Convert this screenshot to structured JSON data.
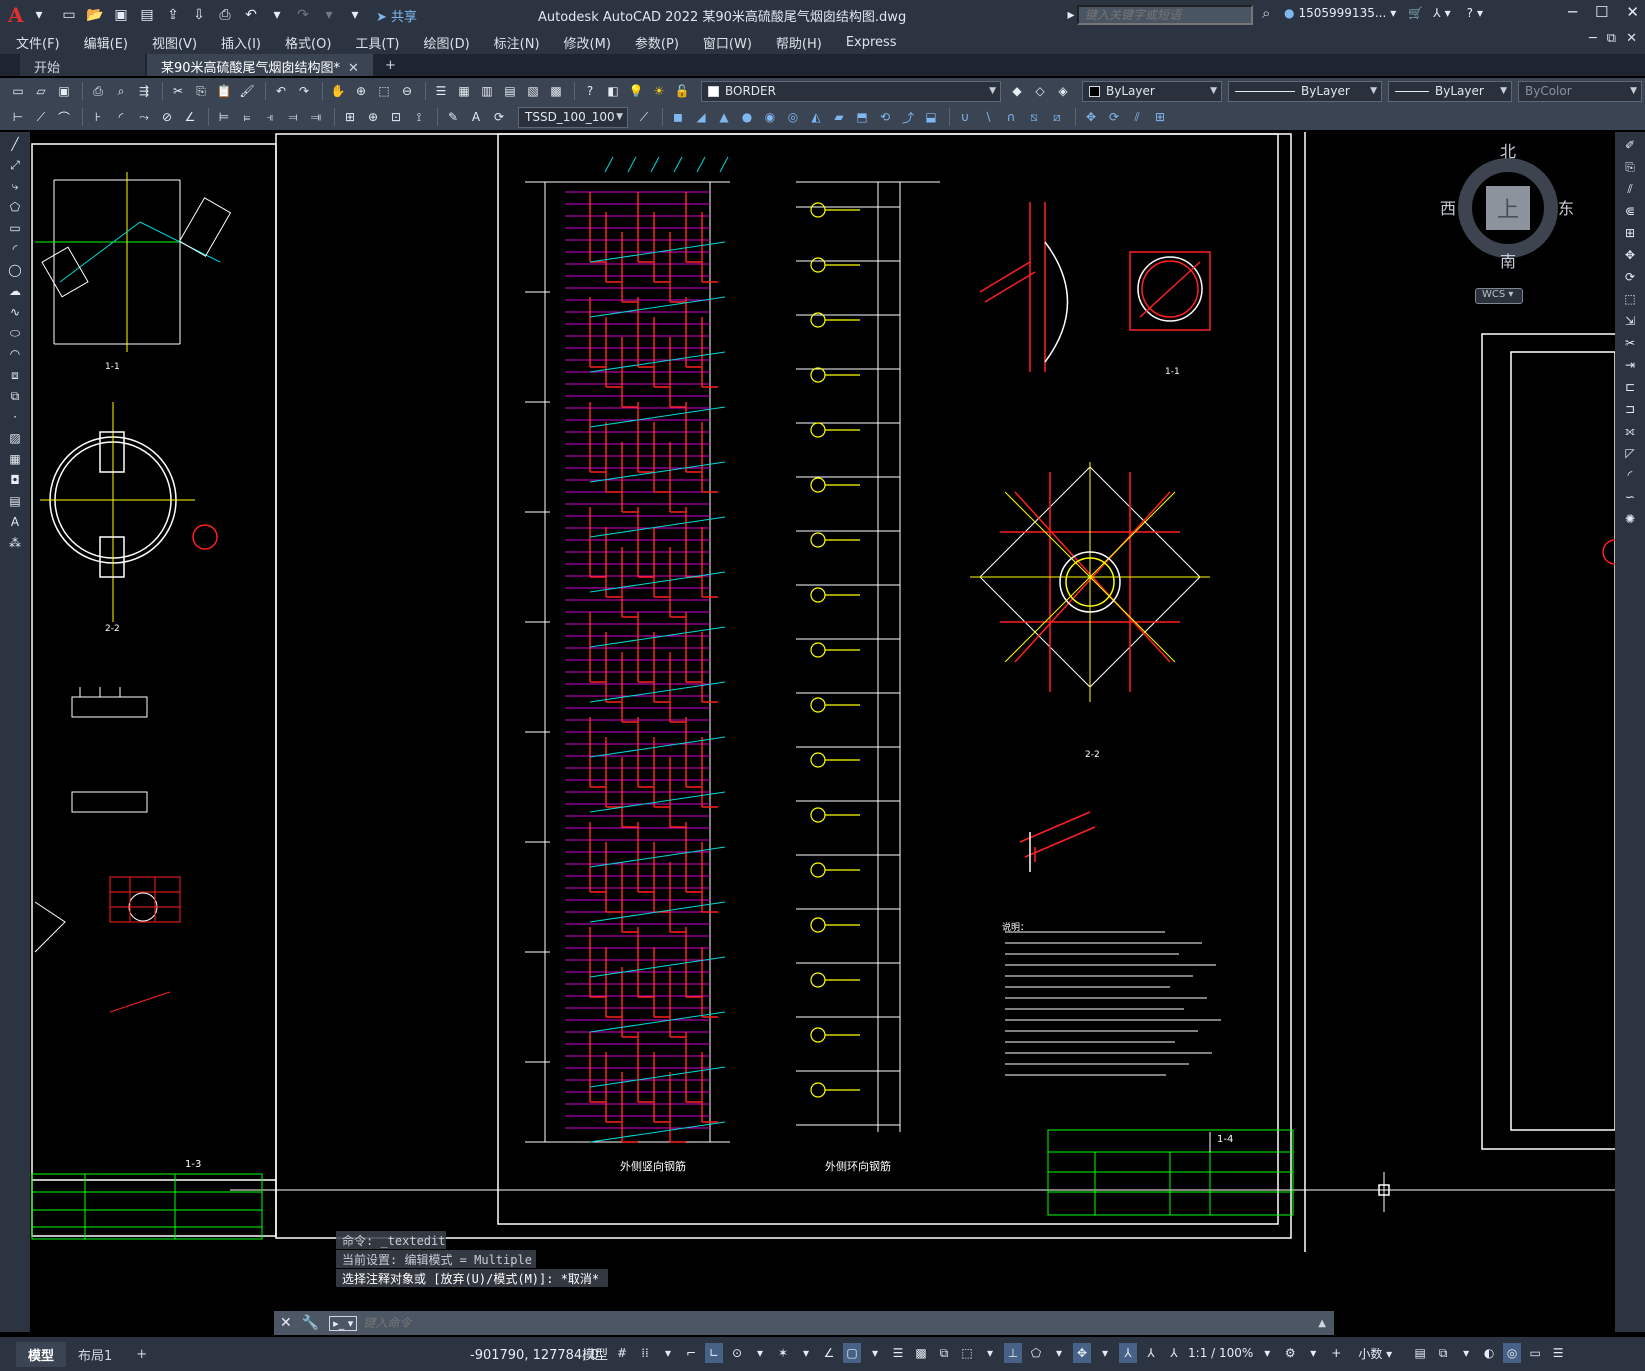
{
  "titlebar": {
    "logo": "A",
    "share_label": "共享",
    "app_title": "Autodesk AutoCAD 2022    某90米高硫酸尾气烟囱结构图.dwg",
    "search_placeholder": "键入关键字或短语",
    "user_name": "1505999135..."
  },
  "menu": [
    "文件(F)",
    "编辑(E)",
    "视图(V)",
    "插入(I)",
    "格式(O)",
    "工具(T)",
    "绘图(D)",
    "标注(N)",
    "修改(M)",
    "参数(P)",
    "窗口(W)",
    "帮助(H)",
    "Express"
  ],
  "tabs": [
    {
      "label": "开始",
      "active": false
    },
    {
      "label": "某90米高硫酸尾气烟囱结构图*",
      "active": true
    }
  ],
  "toolbar": {
    "layer_name": "BORDER",
    "color_value": "ByLayer",
    "linetype_value": "ByLayer",
    "lineweight_value": "ByLayer",
    "plotstyle_value": "ByColor",
    "dimstyle_value": "TSSD_100_100"
  },
  "viewcube": {
    "north": "北",
    "south": "南",
    "east": "东",
    "west": "西",
    "top": "上",
    "wcs": "WCS"
  },
  "drawing": {
    "labels": {
      "outer_vertical_rebar": "外侧竖向钢筋",
      "outer_ring_rebar": "外侧环向钢筋",
      "section_1_1": "1-1",
      "section_2_2": "2-2",
      "section_1_3": "1-3",
      "section_1_4": "1-4",
      "notes_title": "说明："
    }
  },
  "command": {
    "history": [
      "命令: _textedit",
      "当前设置: 编辑模式 = Multiple",
      "选择注释对象或 [放弃(U)/模式(M)]: *取消*"
    ],
    "placeholder": "键入命令"
  },
  "statusbar": {
    "layout_tabs": [
      "模型",
      "布局1"
    ],
    "coordinates": "-901790, 127784, 0",
    "model_label": "模型",
    "scale": "1:1 / 100%",
    "units": "小数"
  },
  "colors": {
    "accent": "#476187",
    "cad_red": "#ff2020",
    "cad_magenta": "#d000d0",
    "cad_cyan": "#00d8d8",
    "cad_yellow": "#ffff00",
    "cad_green": "#00ff00"
  }
}
